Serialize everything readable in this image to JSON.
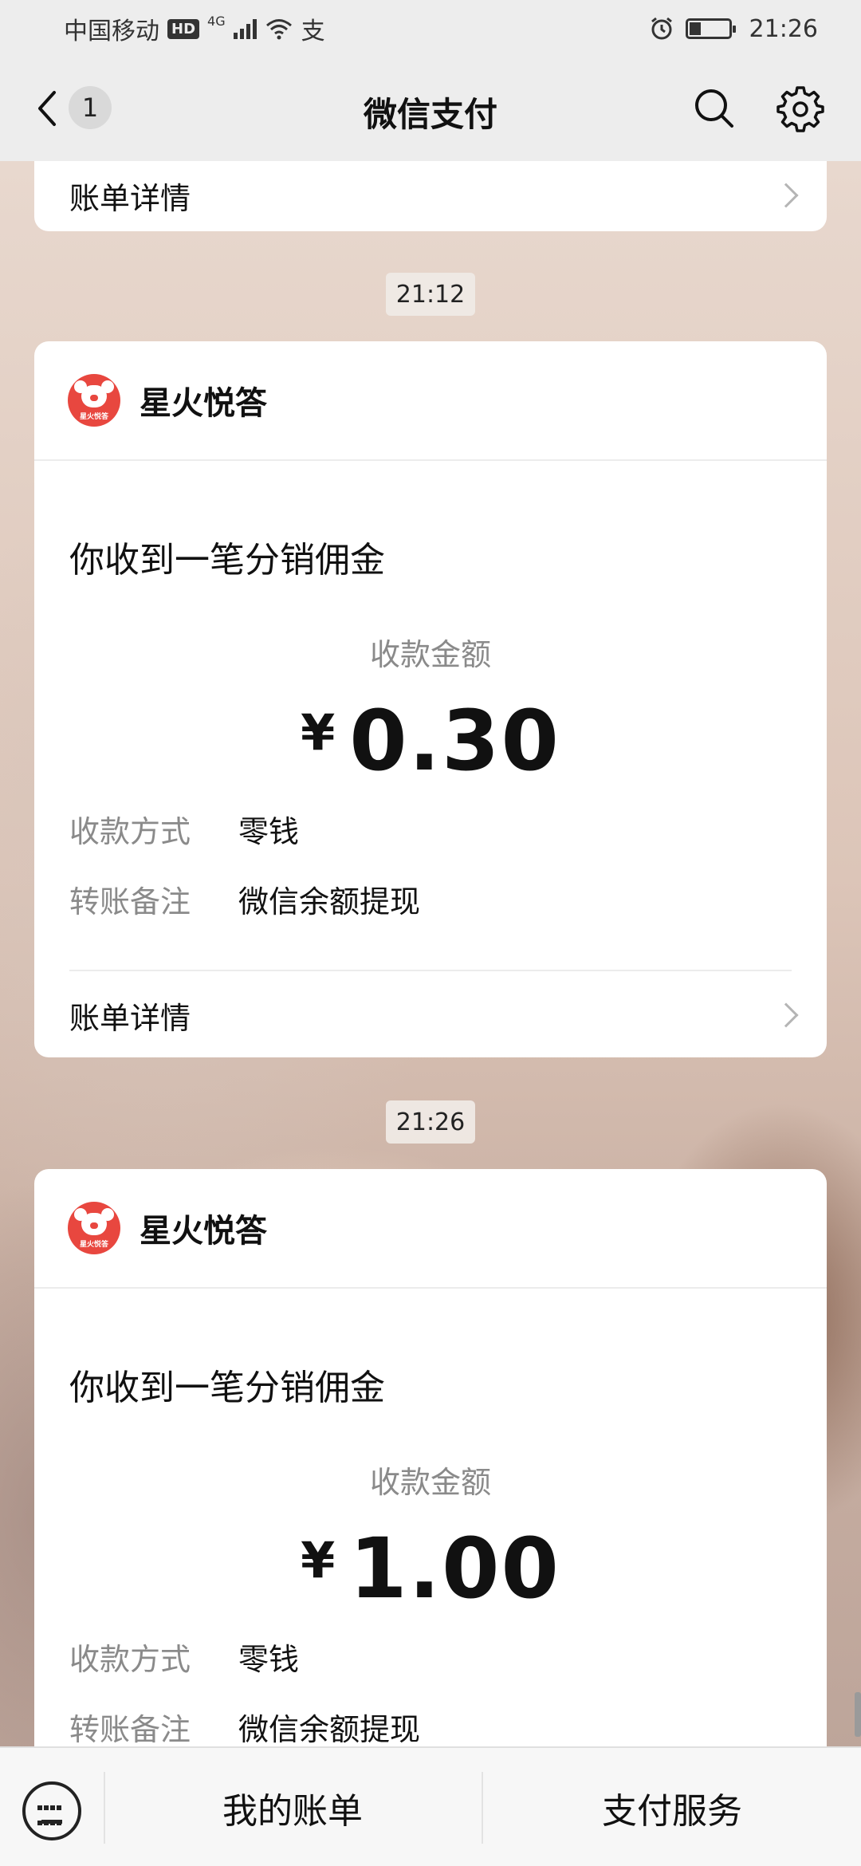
{
  "status_bar": {
    "carrier": "中国移动",
    "hd": "HD",
    "network": "4G",
    "extra_icon": "支",
    "time": "21:26"
  },
  "nav": {
    "unread_count": "1",
    "title": "微信支付"
  },
  "top_card": {
    "detail_label": "账单详情"
  },
  "messages": [
    {
      "time": "21:12",
      "merchant": "星火悦答",
      "logo_text": "星火悦答",
      "title": "你收到一笔分销佣金",
      "amount_label": "收款金额",
      "currency": "¥",
      "amount": "0.30",
      "method_label": "收款方式",
      "method_value": "零钱",
      "note_label": "转账备注",
      "note_value": "微信余额提现",
      "detail_label": "账单详情"
    },
    {
      "time": "21:26",
      "merchant": "星火悦答",
      "logo_text": "星火悦答",
      "title": "你收到一笔分销佣金",
      "amount_label": "收款金额",
      "currency": "¥",
      "amount": "1.00",
      "method_label": "收款方式",
      "method_value": "零钱",
      "note_label": "转账备注",
      "note_value": "微信余额提现"
    }
  ],
  "bottom_bar": {
    "my_bill": "我的账单",
    "pay_service": "支付服务"
  },
  "icons": {
    "back": "chevron-left-icon",
    "search": "search-icon",
    "settings": "gear-icon",
    "keyboard": "keyboard-icon"
  }
}
